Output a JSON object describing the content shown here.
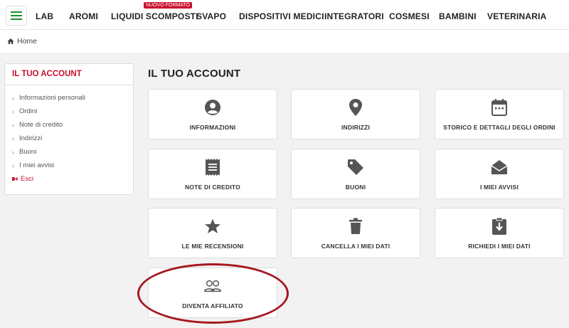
{
  "nav": {
    "items": [
      "LAB",
      "AROMI",
      "LIQUIDI SCOMPOSTI",
      "SVAPO",
      "DISPOSITIVI MEDICI",
      "INTEGRATORI",
      "COSMESI",
      "BAMBINI",
      "VETERINARIA"
    ],
    "badge": "NUOVO FORMATO"
  },
  "breadcrumb": {
    "home": "Home"
  },
  "sidebar": {
    "title": "IL TUO ACCOUNT",
    "items": [
      "Informazioni personali",
      "Ordini",
      "Note di credito",
      "Indirizzi",
      "Buoni",
      "I miei avvisi",
      "Esci"
    ]
  },
  "main": {
    "title": "IL TUO ACCOUNT",
    "cards": [
      {
        "label": "INFORMAZIONI",
        "icon": "user-circle-icon"
      },
      {
        "label": "INDIRIZZI",
        "icon": "location-pin-icon"
      },
      {
        "label": "STORICO E DETTAGLI DEGLI ORDINI",
        "icon": "calendar-icon"
      },
      {
        "label": "NOTE DI CREDITO",
        "icon": "receipt-icon"
      },
      {
        "label": "BUONI",
        "icon": "tag-icon"
      },
      {
        "label": "I MIEI AVVISI",
        "icon": "envelope-open-icon"
      },
      {
        "label": "LE MIE RECENSIONI",
        "icon": "star-icon"
      },
      {
        "label": "CANCELLA I MIEI DATI",
        "icon": "trash-icon"
      },
      {
        "label": "RICHIEDI I MIEI DATI",
        "icon": "clipboard-download-icon"
      },
      {
        "label": "DIVENTA AFFILIATO",
        "icon": "people-icon"
      }
    ]
  },
  "colors": {
    "accent": "#c8102e",
    "menu_green": "#1b8f2e",
    "highlight": "#a6171f"
  }
}
